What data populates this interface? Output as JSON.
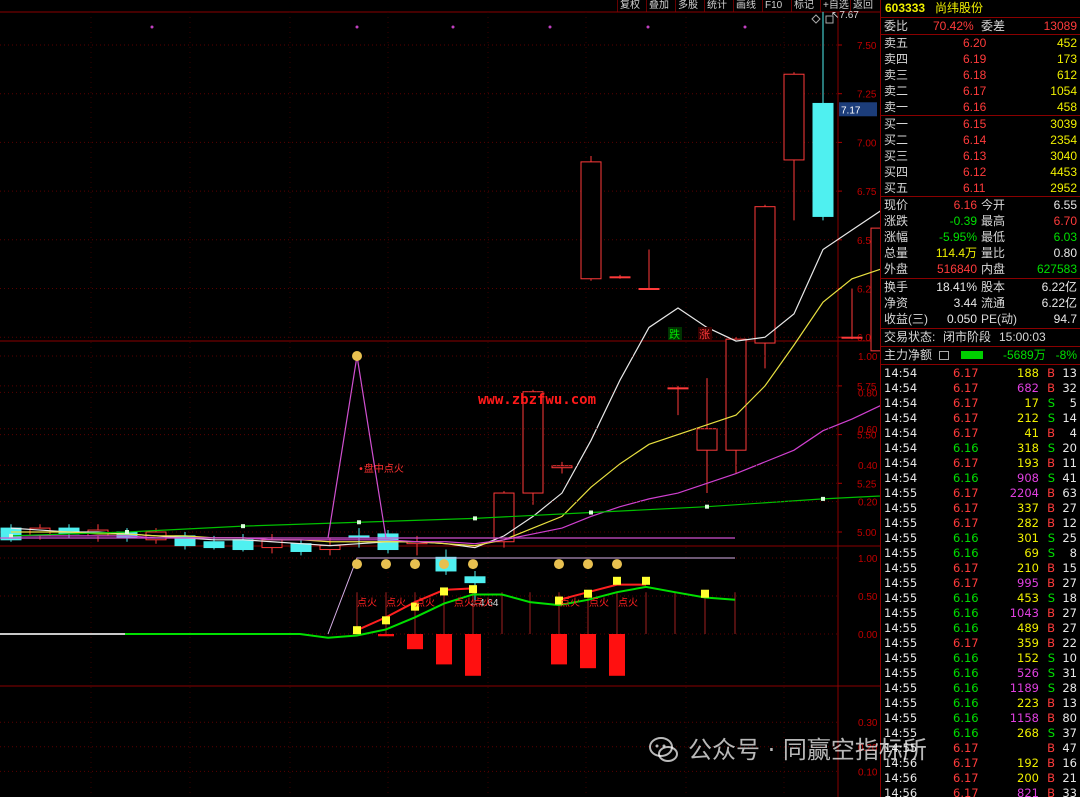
{
  "toolbar": [
    "复权",
    "叠加",
    "多股",
    "统计",
    "画线",
    "F10",
    "标记",
    "+自选",
    "返回"
  ],
  "stock": {
    "code": "603333",
    "name": "尚纬股份"
  },
  "order_book": {
    "weibi_label": "委比",
    "weibi_value": "70.42%",
    "weicha_label": "委差",
    "weicha_value": "13089",
    "asks": [
      {
        "label": "卖五",
        "price": "6.20",
        "vol": "452"
      },
      {
        "label": "卖四",
        "price": "6.19",
        "vol": "173"
      },
      {
        "label": "卖三",
        "price": "6.18",
        "vol": "612"
      },
      {
        "label": "卖二",
        "price": "6.17",
        "vol": "1054"
      },
      {
        "label": "卖一",
        "price": "6.16",
        "vol": "458"
      }
    ],
    "bids": [
      {
        "label": "买一",
        "price": "6.15",
        "vol": "3039"
      },
      {
        "label": "买二",
        "price": "6.14",
        "vol": "2354"
      },
      {
        "label": "买三",
        "price": "6.13",
        "vol": "3040"
      },
      {
        "label": "买四",
        "price": "6.12",
        "vol": "4453"
      },
      {
        "label": "买五",
        "price": "6.11",
        "vol": "2952"
      }
    ]
  },
  "stats": [
    {
      "l1": "现价",
      "v1": "6.16",
      "c1": "red",
      "l2": "今开",
      "v2": "6.55",
      "c2": "wht"
    },
    {
      "l1": "涨跌",
      "v1": "-0.39",
      "c1": "grn",
      "l2": "最高",
      "v2": "6.70",
      "c2": "red"
    },
    {
      "l1": "涨幅",
      "v1": "-5.95%",
      "c1": "grn",
      "l2": "最低",
      "v2": "6.03",
      "c2": "grn"
    },
    {
      "l1": "总量",
      "v1": "114.4万",
      "c1": "yel",
      "l2": "量比",
      "v2": "0.80",
      "c2": "wht"
    },
    {
      "l1": "外盘",
      "v1": "516840",
      "c1": "red",
      "l2": "内盘",
      "v2": "627583",
      "c2": "grn"
    }
  ],
  "stats2": [
    {
      "l1": "换手",
      "v1": "18.41%",
      "l2": "股本",
      "v2": "6.22亿"
    },
    {
      "l1": "净资",
      "v1": "3.44",
      "l2": "流通",
      "v2": "6.22亿"
    },
    {
      "l1": "收益(三)",
      "v1": "0.050",
      "l2": "PE(动)",
      "v2": "94.7"
    }
  ],
  "trade_status": {
    "label": "交易状态:",
    "value": "闭市阶段",
    "time": "15:00:03"
  },
  "main_flow": {
    "label": "主力净额",
    "value": "-5689万",
    "pct": "-8%"
  },
  "ticks": [
    [
      "14:54",
      "6.17",
      "188",
      "B",
      "13"
    ],
    [
      "14:54",
      "6.17",
      "682",
      "B",
      "32"
    ],
    [
      "14:54",
      "6.17",
      "17",
      "S",
      "5"
    ],
    [
      "14:54",
      "6.17",
      "212",
      "S",
      "14"
    ],
    [
      "14:54",
      "6.17",
      "41",
      "B",
      "4"
    ],
    [
      "14:54",
      "6.16",
      "318",
      "S",
      "20"
    ],
    [
      "14:54",
      "6.17",
      "193",
      "B",
      "11"
    ],
    [
      "14:54",
      "6.16",
      "908",
      "S",
      "41"
    ],
    [
      "14:55",
      "6.17",
      "2204",
      "B",
      "63"
    ],
    [
      "14:55",
      "6.17",
      "337",
      "B",
      "27"
    ],
    [
      "14:55",
      "6.17",
      "282",
      "B",
      "12"
    ],
    [
      "14:55",
      "6.16",
      "301",
      "S",
      "25"
    ],
    [
      "14:55",
      "6.16",
      "69",
      "S",
      "8"
    ],
    [
      "14:55",
      "6.17",
      "210",
      "B",
      "15"
    ],
    [
      "14:55",
      "6.17",
      "995",
      "B",
      "27"
    ],
    [
      "14:55",
      "6.16",
      "453",
      "S",
      "18"
    ],
    [
      "14:55",
      "6.16",
      "1043",
      "B",
      "27"
    ],
    [
      "14:55",
      "6.16",
      "489",
      "B",
      "27"
    ],
    [
      "14:55",
      "6.17",
      "359",
      "B",
      "22"
    ],
    [
      "14:55",
      "6.16",
      "152",
      "S",
      "10"
    ],
    [
      "14:55",
      "6.16",
      "526",
      "S",
      "31"
    ],
    [
      "14:55",
      "6.16",
      "1189",
      "S",
      "28"
    ],
    [
      "14:55",
      "6.16",
      "223",
      "B",
      "13"
    ],
    [
      "14:55",
      "6.16",
      "1158",
      "B",
      "80"
    ],
    [
      "14:55",
      "6.16",
      "268",
      "S",
      "37"
    ],
    [
      "14:55",
      "6.17",
      "",
      "B",
      "47"
    ],
    [
      "14:56",
      "6.17",
      "192",
      "B",
      "16"
    ],
    [
      "14:56",
      "6.17",
      "200",
      "B",
      "21"
    ],
    [
      "14:56",
      "6.17",
      "821",
      "B",
      "33"
    ]
  ],
  "chart_data": {
    "type": "candlestick",
    "price_axis": [
      "7.50",
      "7.25",
      "7.00",
      "6.75",
      "6.50",
      "6.25",
      "6.00",
      "5.75",
      "5.50",
      "5.25",
      "5.00"
    ],
    "current_price_tag": "7.17",
    "high_annotation": "7.67",
    "low_annotation": "4.64",
    "candles": [
      {
        "o": 5.02,
        "c": 4.96,
        "h": 5.04,
        "l": 4.95
      },
      {
        "o": 4.98,
        "c": 5.02,
        "h": 5.04,
        "l": 4.96
      },
      {
        "o": 5.02,
        "c": 4.99,
        "h": 5.04,
        "l": 4.97
      },
      {
        "o": 4.98,
        "c": 5.01,
        "h": 5.04,
        "l": 4.95
      },
      {
        "o": 5.0,
        "c": 4.97,
        "h": 5.02,
        "l": 4.95
      },
      {
        "o": 4.96,
        "c": 5.0,
        "h": 5.02,
        "l": 4.94
      },
      {
        "o": 4.98,
        "c": 4.93,
        "h": 5.0,
        "l": 4.91
      },
      {
        "o": 4.95,
        "c": 4.92,
        "h": 4.98,
        "l": 4.91
      },
      {
        "o": 4.96,
        "c": 4.91,
        "h": 4.99,
        "l": 4.9
      },
      {
        "o": 4.92,
        "c": 4.96,
        "h": 4.99,
        "l": 4.89
      },
      {
        "o": 4.94,
        "c": 4.9,
        "h": 4.96,
        "l": 4.88
      },
      {
        "o": 4.91,
        "c": 4.93,
        "h": 4.97,
        "l": 4.88
      },
      {
        "o": 4.98,
        "c": 4.97,
        "h": 5.02,
        "l": 4.92
      },
      {
        "o": 4.99,
        "c": 4.91,
        "h": 5.01,
        "l": 4.89
      },
      {
        "o": 4.94,
        "c": 4.95,
        "h": 4.98,
        "l": 4.88
      },
      {
        "o": 4.87,
        "c": 4.8,
        "h": 4.91,
        "l": 4.78
      },
      {
        "o": 4.77,
        "c": 4.74,
        "h": 4.8,
        "l": 4.64
      },
      {
        "o": 4.95,
        "c": 5.2,
        "h": 5.21,
        "l": 4.92
      },
      {
        "o": 5.2,
        "c": 5.72,
        "h": 5.73,
        "l": 5.14
      },
      {
        "o": 5.33,
        "c": 5.34,
        "h": 5.36,
        "l": 5.3
      },
      {
        "o": 6.3,
        "c": 6.9,
        "h": 6.93,
        "l": 6.29
      },
      {
        "o": 6.31,
        "c": 6.31,
        "h": 6.32,
        "l": 6.3
      },
      {
        "o": 6.25,
        "c": 6.25,
        "h": 6.45,
        "l": 6.25
      },
      {
        "o": 5.74,
        "c": 5.74,
        "h": 5.75,
        "l": 5.6
      },
      {
        "o": 5.42,
        "c": 5.53,
        "h": 5.79,
        "l": 5.2
      },
      {
        "o": 5.42,
        "c": 5.99,
        "h": 6.0,
        "l": 5.3
      },
      {
        "o": 5.97,
        "c": 6.67,
        "h": 6.68,
        "l": 5.84
      },
      {
        "o": 6.91,
        "c": 7.35,
        "h": 7.36,
        "l": 6.6
      },
      {
        "o": 7.2,
        "c": 6.62,
        "h": 7.67,
        "l": 6.6
      },
      {
        "o": 6.0,
        "c": 6.0,
        "h": 6.25,
        "l": 5.99
      },
      {
        "o": 5.93,
        "c": 6.56,
        "h": 6.57,
        "l": 5.92
      },
      {
        "o": 6.55,
        "c": 6.16,
        "h": 6.7,
        "l": 6.03
      }
    ],
    "ma5": [
      5.02,
      5.01,
      5.0,
      5.0,
      4.99,
      4.98,
      4.97,
      4.96,
      4.96,
      4.95,
      4.94,
      4.93,
      4.94,
      4.95,
      4.95,
      4.94,
      4.92,
      4.98,
      5.08,
      5.2,
      5.47,
      5.78,
      6.05,
      6.15,
      6.05,
      5.98,
      6.0,
      6.12,
      6.45,
      6.55,
      6.65,
      6.55
    ],
    "ma10": [
      5.0,
      5.0,
      5.0,
      4.99,
      4.99,
      4.98,
      4.98,
      4.97,
      4.97,
      4.96,
      4.96,
      4.95,
      4.95,
      4.95,
      4.95,
      4.94,
      4.93,
      4.96,
      5.02,
      5.08,
      5.23,
      5.35,
      5.45,
      5.5,
      5.55,
      5.6,
      5.75,
      5.96,
      6.18,
      6.3,
      6.35,
      6.3
    ],
    "ma20": [
      4.98,
      4.98,
      4.98,
      4.98,
      4.98,
      4.97,
      4.97,
      4.97,
      4.97,
      4.96,
      4.96,
      4.96,
      4.96,
      4.96,
      4.95,
      4.95,
      4.94,
      4.96,
      4.99,
      5.02,
      5.08,
      5.13,
      5.17,
      5.2,
      5.25,
      5.3,
      5.36,
      5.42,
      5.52,
      5.58,
      5.65,
      5.73
    ],
    "ma60_points": [
      4.98,
      5.0,
      5.03,
      5.05,
      5.07,
      5.1,
      5.13,
      5.17,
      5.2
    ],
    "up_down_labels": [
      "跌",
      "涨"
    ],
    "panel2": {
      "axis": [
        "1.00",
        "0.80",
        "0.60",
        "0.40",
        "0.20"
      ],
      "peak_value": 1.0,
      "label": "•盘中点火",
      "watermark": "www.zbzfwu.com"
    },
    "panel3": {
      "axis": [
        "1.00",
        "0.50",
        "0.00"
      ],
      "signal_label": "点火",
      "bars": [
        0,
        0,
        0,
        0,
        0,
        0,
        0,
        0,
        0,
        0,
        0,
        0,
        -0.02,
        -0.2,
        -0.4,
        -0.55,
        0,
        0,
        0,
        0,
        0,
        0,
        -0.4,
        -0.45,
        -0.55,
        0,
        0,
        0,
        0
      ],
      "green_line": [
        0,
        0,
        0,
        0,
        0,
        0,
        0,
        0,
        0,
        0,
        0,
        0,
        0,
        0,
        0.08,
        0.2,
        0.38,
        0.52,
        0.52,
        0.45,
        0.4,
        0.42,
        0.55,
        0.62,
        0.65,
        0.58,
        0.52,
        0.45
      ],
      "red_line": [
        0,
        0.1,
        0.3,
        0.5,
        0.62,
        0.62,
        0,
        0,
        0,
        0.45,
        0.58,
        0.65,
        0.66
      ]
    },
    "panel4": {
      "axis": [
        "0.30",
        "0.20",
        "0.10"
      ]
    }
  },
  "watermark": "公众号 · 同赢空指标所"
}
